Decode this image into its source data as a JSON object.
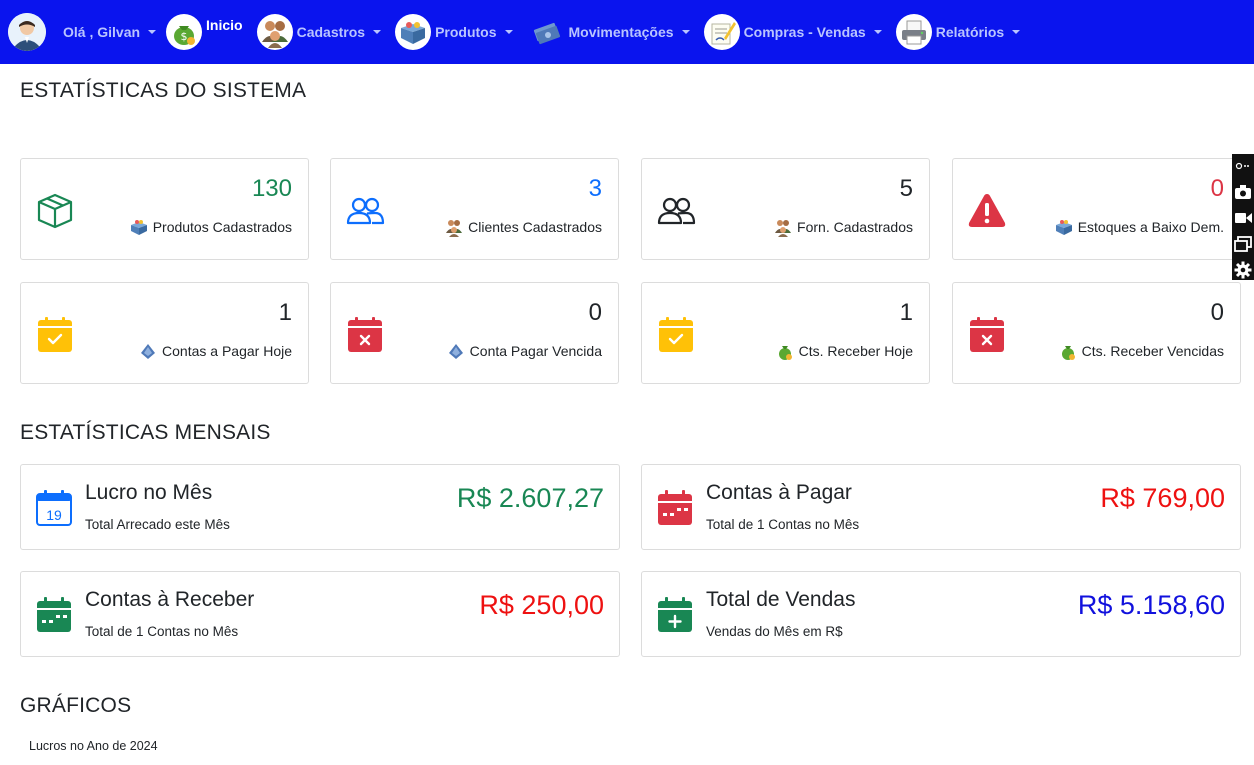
{
  "navbar": {
    "user_greeting": "Olá , Gilvan",
    "home_label": "Inicio",
    "menus": [
      {
        "label": "Cadastros"
      },
      {
        "label": "Produtos"
      },
      {
        "label": "Movimentações"
      },
      {
        "label": "Compras - Vendas"
      },
      {
        "label": "Relatórios"
      }
    ],
    "bg_color": "#0a14ee"
  },
  "sections": {
    "system_stats": "ESTATÍSTICAS DO SISTEMA",
    "monthly_stats": "ESTATÍSTICAS MENSAIS",
    "charts": "GRÁFICOS"
  },
  "stat_cards": [
    {
      "value": "130",
      "label": "Produtos Cadastrados",
      "color": "#198754",
      "icon": "box-icon"
    },
    {
      "value": "3",
      "label": "Clientes Cadastrados",
      "color": "#0d6efd",
      "icon": "people-icon"
    },
    {
      "value": "5",
      "label": "Forn. Cadastrados",
      "color": "#212529",
      "icon": "people-icon"
    },
    {
      "value": "0",
      "label": "Estoques a Baixo Dem.",
      "color": "#dc3545",
      "icon": "warning-icon"
    },
    {
      "value": "1",
      "label": "Contas a Pagar Hoje",
      "color": "#212529",
      "icon": "calendar-check-icon"
    },
    {
      "value": "0",
      "label": "Conta Pagar Vencida",
      "color": "#212529",
      "icon": "calendar-x-icon"
    },
    {
      "value": "1",
      "label": "Cts. Receber Hoje",
      "color": "#212529",
      "icon": "calendar-check-icon"
    },
    {
      "value": "0",
      "label": "Cts. Receber Vencidas",
      "color": "#212529",
      "icon": "calendar-x-icon"
    }
  ],
  "month_cards": [
    {
      "title": "Lucro no Mês",
      "sub": "Total Arrecado este Mês",
      "amount": "R$ 2.607,27",
      "color": "#198754"
    },
    {
      "title": "Contas à Pagar",
      "sub": "Total de 1 Contas no Mês",
      "amount": "R$ 769,00",
      "color": "#ee1111"
    },
    {
      "title": "Contas à Receber",
      "sub": "Total de 1 Contas no Mês",
      "amount": "R$ 250,00",
      "color": "#ee1111"
    },
    {
      "title": "Total de Vendas",
      "sub": "Vendas do Mês em R$",
      "amount": "R$ 5.158,60",
      "color": "#1111dd"
    }
  ],
  "chart_caption": "Lucros no Ano de 2024"
}
